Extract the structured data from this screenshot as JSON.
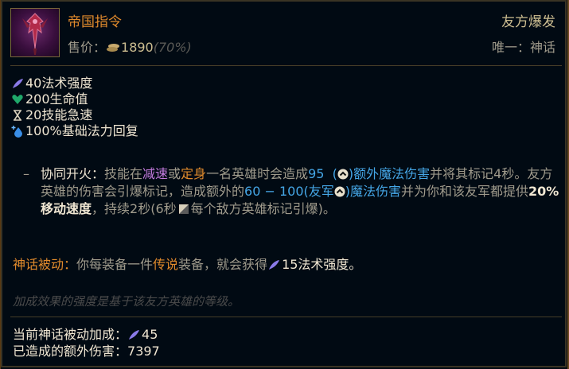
{
  "item": {
    "name": "帝国指令",
    "price_label": "售价：",
    "price_value": "1890",
    "price_percent": "(70%)",
    "type": "友方爆发",
    "tier": "唯一：神话"
  },
  "stats": [
    {
      "icon": "ability-power-icon",
      "text": "40法术强度"
    },
    {
      "icon": "health-icon",
      "text": "200生命值"
    },
    {
      "icon": "ability-haste-icon",
      "text": "20技能急速"
    },
    {
      "icon": "mana-regen-icon",
      "text": "100%基础法力回复"
    }
  ],
  "passive": {
    "title": "协同开火：",
    "t1": "技能在",
    "slow": "减速",
    "t2": "或",
    "immobilize": "定身",
    "t3": "一名英雄时会造成",
    "dmg1": "95",
    "magic1": "额外魔法伤害",
    "t4": "并将其标记4秒。友方英雄的伤害会引爆标记，造成额外的",
    "dmg2": "60 − 100(友军",
    "magic2": ")魔法伤害",
    "t5": "并为你和该友军都提供",
    "ms": "20%移动速度",
    "t6": "，持续2秒(6秒",
    "t7": "每个敌方英雄标记引爆)。"
  },
  "mythic": {
    "title": "神话被动：",
    "t1": "你每装备一件",
    "legend": "传说",
    "t2": "装备，就会获得",
    "ap": "15法术强度。"
  },
  "note": "加成效果的强度是基于该友方英雄的等级。",
  "totals": {
    "mythic_label": "当前神话被动加成：",
    "mythic_value": "45",
    "damage_label": "已造成的额外伤害：",
    "damage_value": "7397"
  },
  "colors": {
    "title_orange": "#e08a2c",
    "magic_blue": "#45a6e6",
    "crowd_control_purple": "#c47bde",
    "text_white": "#f0e6d2",
    "text_gray": "#a09b8c"
  }
}
